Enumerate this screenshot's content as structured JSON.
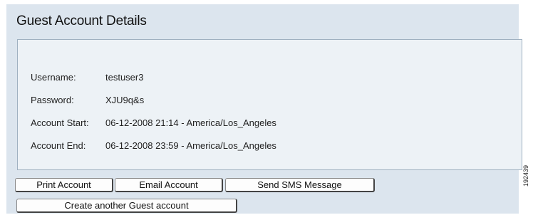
{
  "page_title": "Guest Account Details",
  "details": {
    "username_label": "Username:",
    "username_value": "testuser3",
    "password_label": "Password:",
    "password_value": "XJU9q&s",
    "start_label": "Account Start:",
    "start_value": "06-12-2008 21:14 - America/Los_Angeles",
    "end_label": "Account End:",
    "end_value": "06-12-2008 23:59 - America/Los_Angeles"
  },
  "buttons": {
    "print": "Print Account",
    "email": "Email Account",
    "sms": "Send SMS Message",
    "create": "Create another Guest account"
  },
  "figure_id": "192439"
}
